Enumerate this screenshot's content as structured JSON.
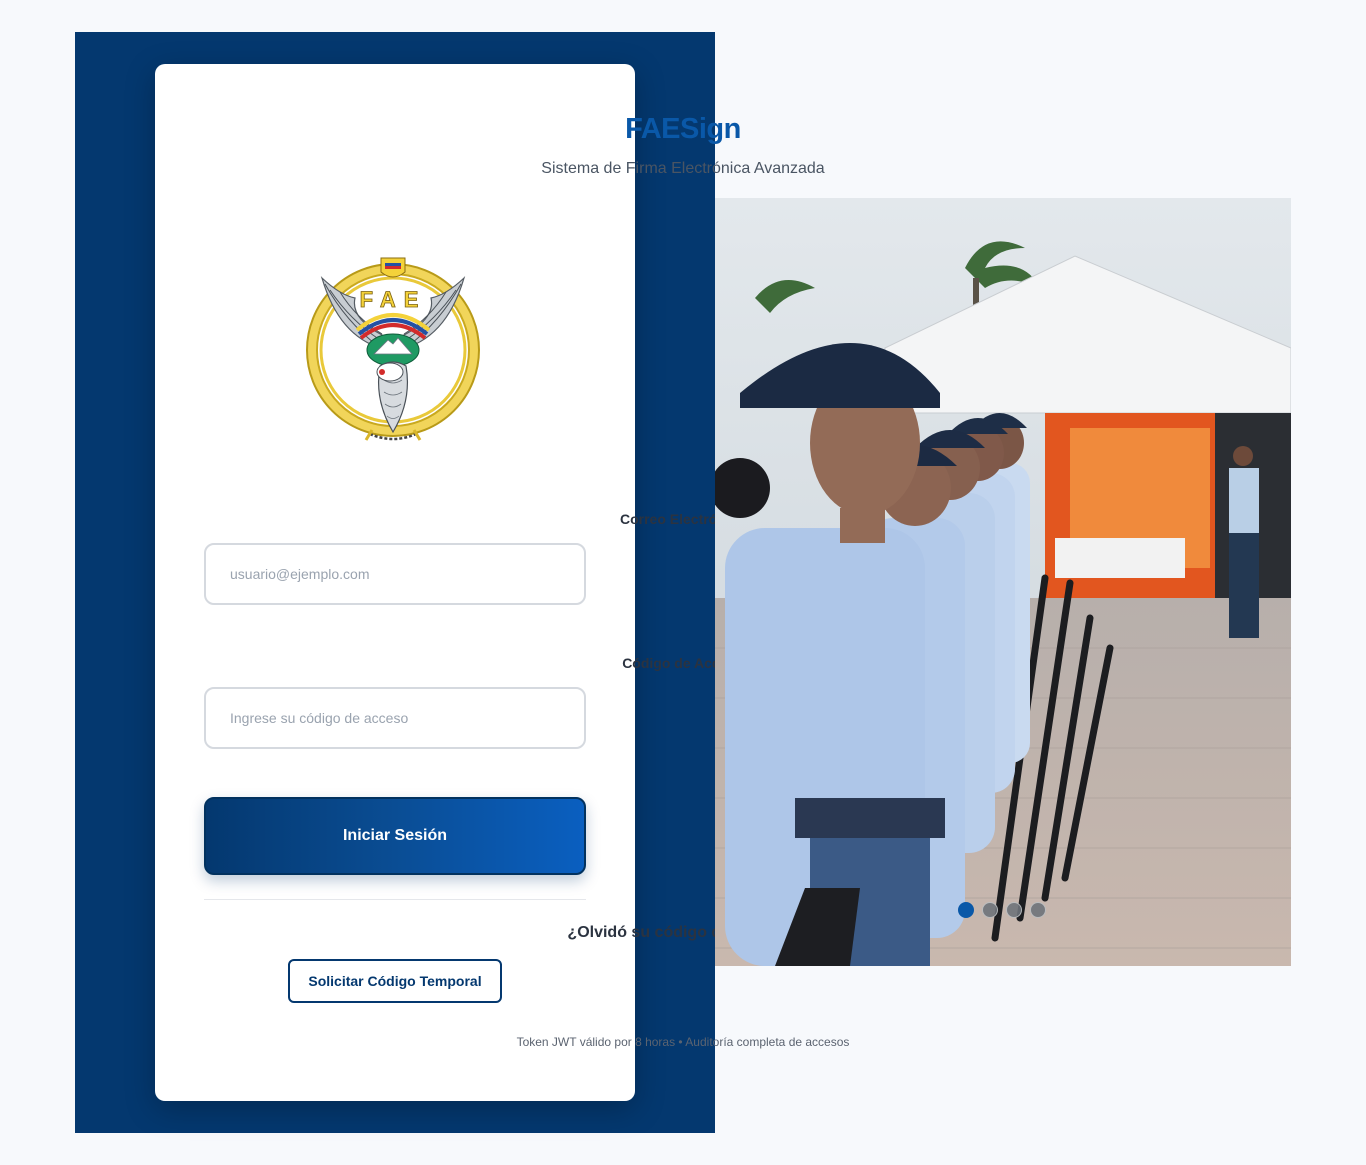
{
  "brand": {
    "title": "FAESign",
    "subtitle": "Sistema de Firma Electrónica Avanzada",
    "emblem_text": "FAE"
  },
  "form": {
    "email_label": "Correo Electrónico",
    "email_placeholder": "usuario@ejemplo.com",
    "email_value": "",
    "code_label": "Código de Acceso",
    "code_placeholder": "Ingrese su código de acceso",
    "code_value": "",
    "submit_label": "Iniciar Sesión"
  },
  "recovery": {
    "question": "¿Olvidó su código de acceso?",
    "button_label": "Solicitar Código Temporal"
  },
  "footer": {
    "note": "Token JWT válido por 8 horas • Auditoría completa de accesos"
  },
  "carousel": {
    "slide_count": 4,
    "active_index": 0
  },
  "colors": {
    "primary": "#04386f",
    "brand_title": "#0a58a8",
    "background": "#f7f9fc",
    "active_dot": "#0a58a8"
  }
}
